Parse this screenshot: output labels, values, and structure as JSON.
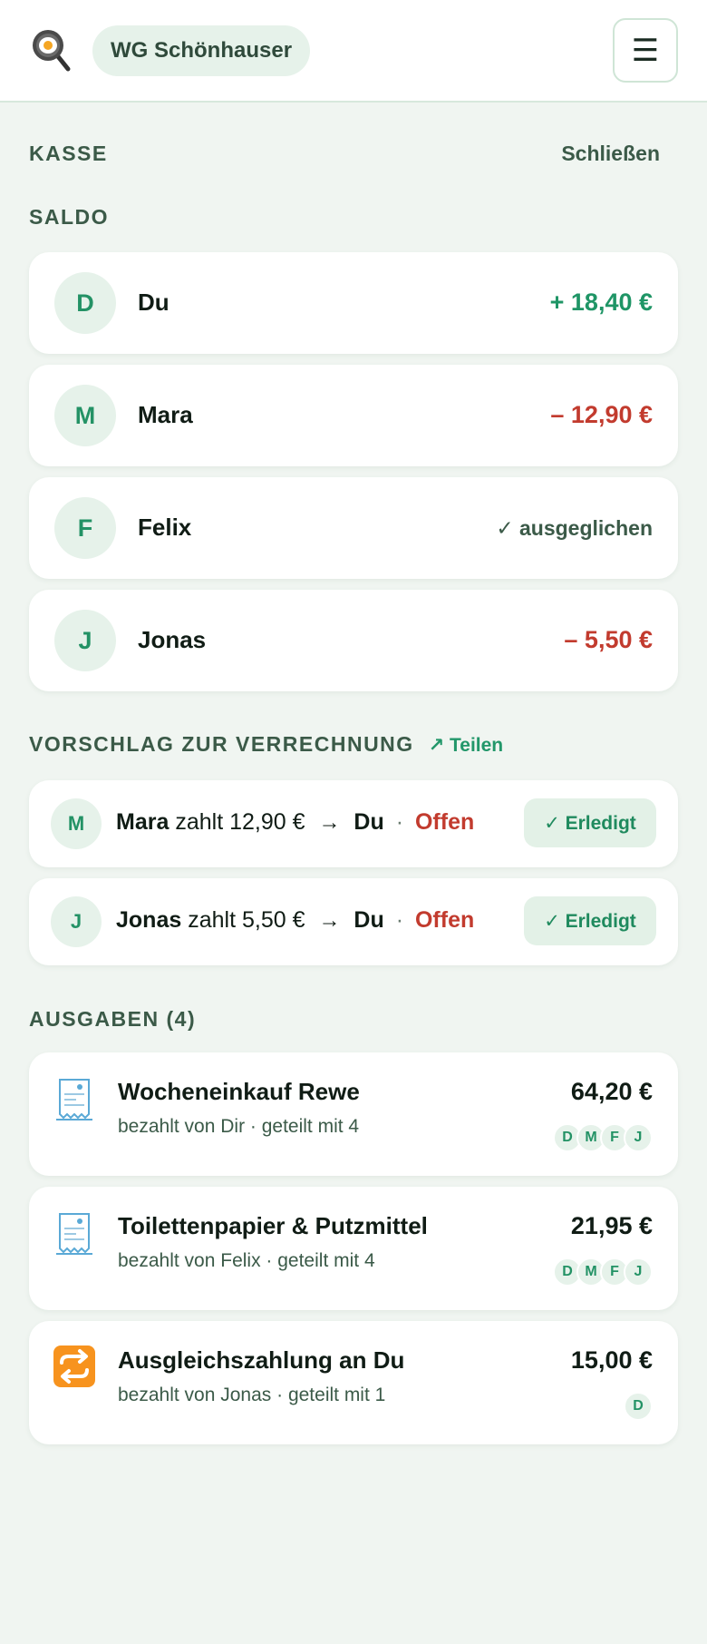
{
  "header": {
    "logo_icon": "frying-pan-egg-icon",
    "group_name": "WG Schönhauser",
    "menu_glyph": "☰"
  },
  "kasse": {
    "label": "KASSE",
    "close_label": "Schließen"
  },
  "saldo": {
    "label": "SALDO",
    "members": [
      {
        "initial": "D",
        "name": "Du",
        "amount": "+ 18,40 €",
        "status": "positive"
      },
      {
        "initial": "M",
        "name": "Mara",
        "amount": "– 12,90 €",
        "status": "negative"
      },
      {
        "initial": "F",
        "name": "Felix",
        "amount": "✓ ausgeglichen",
        "status": "settled"
      },
      {
        "initial": "J",
        "name": "Jonas",
        "amount": "– 5,50 €",
        "status": "negative"
      }
    ]
  },
  "settlement": {
    "label": "VORSCHLAG ZUR VERRECHNUNG",
    "share_label": "↗ Teilen",
    "items": [
      {
        "initial": "M",
        "from": "Mara",
        "verb": "zahlt",
        "amount": "12,90 €",
        "arrow": "→",
        "to": "Du",
        "sep": "·",
        "status": "Offen",
        "button": "✓ Erledigt"
      },
      {
        "initial": "J",
        "from": "Jonas",
        "verb": "zahlt",
        "amount": "5,50 €",
        "arrow": "→",
        "to": "Du",
        "sep": "·",
        "status": "Offen",
        "button": "✓ Erledigt"
      }
    ]
  },
  "expenses": {
    "label": "AUSGABEN (4)",
    "items": [
      {
        "icon": "receipt-icon",
        "title": "Wocheneinkauf Rewe",
        "subtitle": "bezahlt von Dir · geteilt mit 4",
        "amount": "64,20 €",
        "chips": [
          "D",
          "M",
          "F",
          "J"
        ]
      },
      {
        "icon": "receipt-icon",
        "title": "Toilettenpapier & Putzmittel",
        "subtitle": "bezahlt von Felix · geteilt mit 4",
        "amount": "21,95 €",
        "chips": [
          "D",
          "M",
          "F",
          "J"
        ]
      },
      {
        "icon": "repeat-arrows-icon",
        "title": "Ausgleichszahlung an Du",
        "subtitle": "bezahlt von Jonas · geteilt mit 1",
        "amount": "15,00 €",
        "chips": [
          "D"
        ]
      }
    ]
  },
  "colors": {
    "positive": "#1f9566",
    "negative": "#c23b2e",
    "accent_bg": "#e6f2ea",
    "page_bg": "#f0f5f1"
  }
}
